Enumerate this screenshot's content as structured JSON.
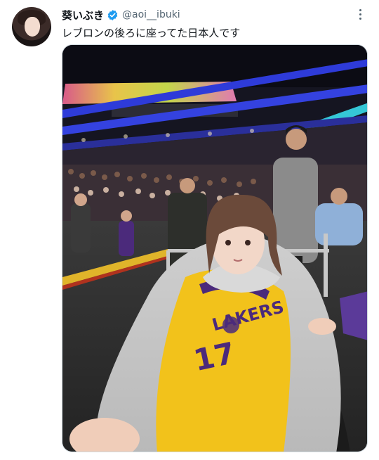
{
  "tweet": {
    "author_name": "葵いぶき",
    "handle": "@aoi__ibuki",
    "text": "レブロンの後ろに座ってた日本人です",
    "verified": true
  },
  "icons": {
    "verified": "verified-badge-icon",
    "more": "more-options-icon"
  },
  "colors": {
    "verified_blue": "#1d9bf0",
    "secondary_text": "#536471",
    "jersey_yellow": "#f2c21b",
    "lakers_purple": "#4b2a7b"
  },
  "photo": {
    "jersey_brand": "LAKERS",
    "jersey_number": "17"
  }
}
